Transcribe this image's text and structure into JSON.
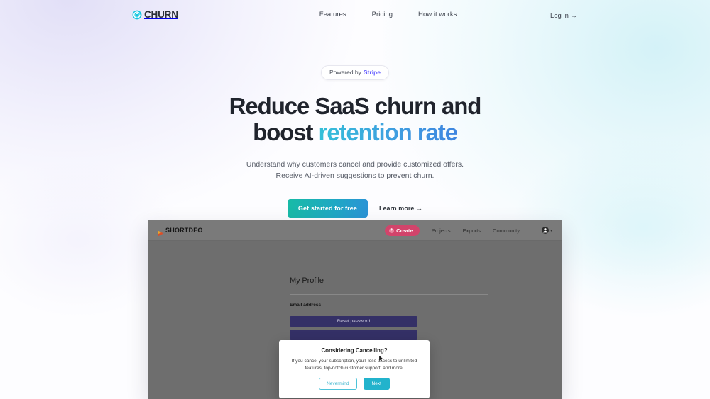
{
  "header": {
    "brand": {
      "name": "CHURN",
      "icon": "churn-swirl-icon",
      "color": "#1ec8e0"
    },
    "nav": [
      {
        "label": "Features"
      },
      {
        "label": "Pricing"
      },
      {
        "label": "How it works"
      }
    ],
    "login": {
      "label": "Log in →"
    }
  },
  "hero": {
    "badge": {
      "prefix": "Powered by",
      "brand": "Stripe",
      "brand_color": "#635bff"
    },
    "title_line1": "Reduce SaaS churn and",
    "title_line2_plain": "boost ",
    "title_line2_accent": "retention rate",
    "accent_gradient_from": "#35c0d8",
    "accent_gradient_to": "#3f86e0",
    "subtitle_line1": "Understand why customers cancel and provide customized offers.",
    "subtitle_line2": "Receive AI-driven suggestions to prevent churn.",
    "cta_primary": "Get started for free",
    "cta_secondary": "Learn more →"
  },
  "mockup": {
    "brand": {
      "name": "SHORTDEO",
      "icon": "play-triangle-icon"
    },
    "create_button": {
      "label": "Create",
      "icon": "plus-circle-icon",
      "color": "#d2446b"
    },
    "nav": [
      {
        "label": "Projects"
      },
      {
        "label": "Exports"
      },
      {
        "label": "Community"
      }
    ],
    "account": {
      "icon": "user-avatar-icon",
      "chevron": "▾"
    },
    "profile": {
      "title": "My Profile",
      "field_label": "Email address",
      "reset_button": "Reset password"
    },
    "modal": {
      "title": "Considering Cancelling?",
      "body_line1": "If you cancel your subscription, you'll lose access to",
      "body_line2": "unlimited features, top-notch customer support, and more.",
      "cancel_button": "Nevermind",
      "confirm_button": "Next",
      "accent_color": "#22b3cc"
    },
    "cursor": {
      "icon": "mouse-pointer-icon"
    }
  }
}
